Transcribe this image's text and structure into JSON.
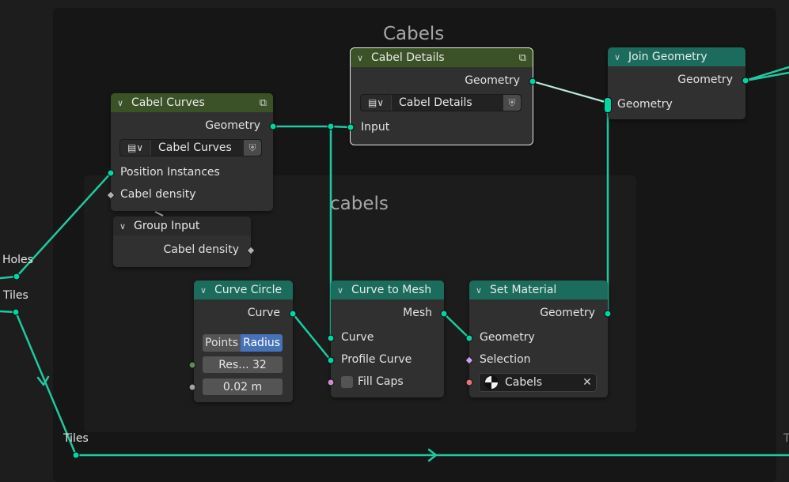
{
  "frames": {
    "outer_label": "Cabels",
    "inner_label": "cabels"
  },
  "colors": {
    "geometry_socket": "#00d6a3",
    "group_header": "#3b5226",
    "geometry_header": "#1b6c5c",
    "toggle_active": "#4672b9"
  },
  "nodes": {
    "cabel_curves": {
      "title": "Cabel Curves",
      "header_icon": "node-tree-icon",
      "output_geometry": "Geometry",
      "selector_icon": "node-tree-icon",
      "selector_name": "Cabel Curves",
      "fake_user_icon": "shield-icon",
      "input_position": "Position Instances",
      "input_density": "Cabel density"
    },
    "cabel_details": {
      "title": "Cabel Details",
      "header_icon": "node-tree-icon",
      "output_geometry": "Geometry",
      "selector_icon": "node-tree-icon",
      "selector_name": "Cabel Details",
      "fake_user_icon": "shield-icon",
      "input": "Input"
    },
    "join_geometry": {
      "title": "Join Geometry",
      "output_geometry": "Geometry",
      "input_geometry": "Geometry"
    },
    "group_input": {
      "title": "Group Input",
      "output_density": "Cabel density"
    },
    "curve_circle": {
      "title": "Curve Circle",
      "output_curve": "Curve",
      "mode_points": "Points",
      "mode_radius": "Radius",
      "resolution": "Res...   32",
      "radius": "0.02 m"
    },
    "curve_to_mesh": {
      "title": "Curve to Mesh",
      "output_mesh": "Mesh",
      "input_curve": "Curve",
      "input_profile": "Profile Curve",
      "input_fill_caps": "Fill Caps"
    },
    "set_material": {
      "title": "Set Material",
      "output_geometry": "Geometry",
      "input_geometry": "Geometry",
      "input_selection": "Selection",
      "material": "Cabels",
      "clear_icon": "close-icon"
    }
  },
  "reroutes": {
    "holes": "Holes",
    "tiles_upper": "Tiles",
    "tiles_lower": "Tiles",
    "right_edge_label": "T"
  }
}
